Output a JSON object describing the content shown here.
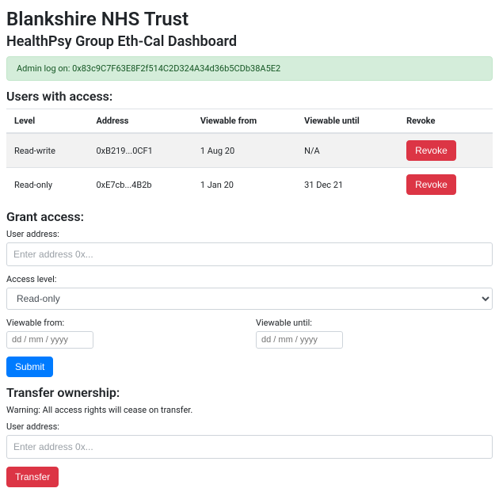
{
  "header": {
    "title": "Blankshire NHS Trust",
    "subtitle": "HealthPsy Group Eth-Cal Dashboard",
    "admin_banner": "Admin log on: 0x83c9C7F63E8F2f514C2D324A34d36b5CDb38A5E2"
  },
  "users_section": {
    "heading": "Users with access:",
    "columns": {
      "level": "Level",
      "address": "Address",
      "viewable_from": "Viewable from",
      "viewable_until": "Viewable until",
      "revoke": "Revoke"
    },
    "rows": [
      {
        "level": "Read-write",
        "address": "0xB219...0CF1",
        "from": "1 Aug 20",
        "until": "N/A"
      },
      {
        "level": "Read-only",
        "address": "0xE7cb...4B2b",
        "from": "1 Jan 20",
        "until": "31 Dec 21"
      }
    ],
    "revoke_label": "Revoke"
  },
  "grant_section": {
    "heading": "Grant access:",
    "user_address_label": "User address:",
    "user_address_placeholder": "Enter address 0x...",
    "access_level_label": "Access level:",
    "access_level_value": "Read-only",
    "viewable_from_label": "Viewable from:",
    "viewable_until_label": "Viewable until:",
    "date_placeholder": "dd / mm / yyyy",
    "submit_label": "Submit"
  },
  "transfer_section": {
    "heading": "Transfer ownership:",
    "warning": "Warning: All access rights will cease on transfer.",
    "user_address_label": "User address:",
    "user_address_placeholder": "Enter address 0x...",
    "transfer_label": "Transfer"
  }
}
